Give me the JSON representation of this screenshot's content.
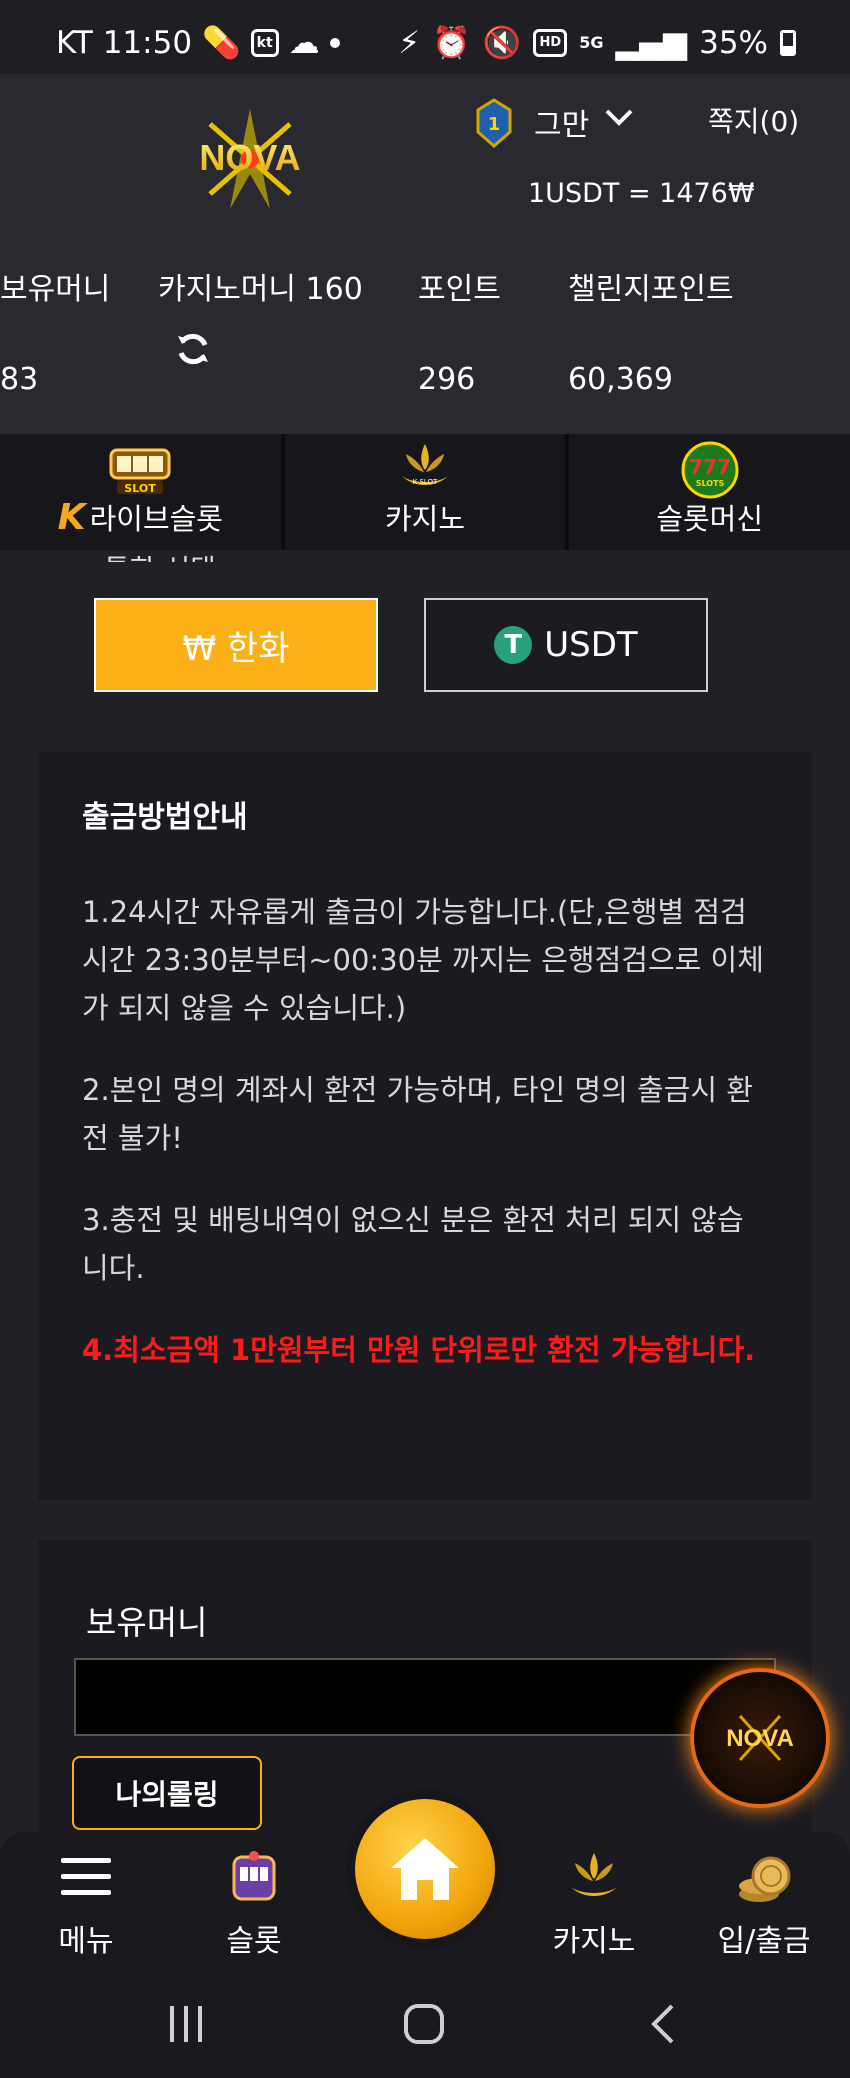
{
  "status_bar": {
    "carrier_time": "KT 11:50",
    "kt_badge": "kt",
    "hd_badge": "HD",
    "net_5g": "5G",
    "battery": "35%"
  },
  "header": {
    "logo_text": "NOVA",
    "level": "1",
    "user_name": "그만",
    "message_link": "쪽지(0)",
    "exchange_rate": "1USDT = 1476₩"
  },
  "stats": [
    {
      "label": "보유머니",
      "value": "83"
    },
    {
      "label": "카지노머니 160",
      "value": ""
    },
    {
      "label": "포인트",
      "value": "296"
    },
    {
      "label": "챌린지포인트",
      "value": "60,369"
    }
  ],
  "categories": [
    {
      "label": "라이브슬롯",
      "icon": "live-slot-icon",
      "k_mark": "K"
    },
    {
      "label": "카지노",
      "icon": "k-slot-casino-icon"
    },
    {
      "label": "슬롯머신",
      "icon": "777-slots-icon"
    }
  ],
  "currency": {
    "cut_heading": "통화 선택",
    "krw_label": "₩ 한화",
    "usdt_label": "USDT",
    "usdt_mark": "T"
  },
  "info": {
    "title": "출금방법안내",
    "items": [
      "1.24시간 자유롭게 출금이 가능합니다.(단,은행별 점검시간 23:30분부터~00:30분 까지는 은행점검으로 이체가 되지 않을 수 있습니다.)",
      "2.본인 명의 계좌시 환전 가능하며, 타인 명의 출금시 환전 불가!",
      "3.충전 및 배팅내역이 없으신 분은 환전 처리 되지 않습니다.",
      "4.최소금액 1만원부터 만원 단위로만 환전 가능합니다."
    ]
  },
  "balance": {
    "title": "보유머니",
    "value": "",
    "rolling_button": "나의롤링"
  },
  "bottom_nav": [
    {
      "label": "메뉴"
    },
    {
      "label": "슬롯"
    },
    {
      "label": "카지노"
    },
    {
      "label": "입/출금"
    }
  ],
  "colors": {
    "accent": "#fbb017",
    "background": "#212025",
    "panel": "#1b1a20",
    "warning": "#ff1a1a"
  }
}
